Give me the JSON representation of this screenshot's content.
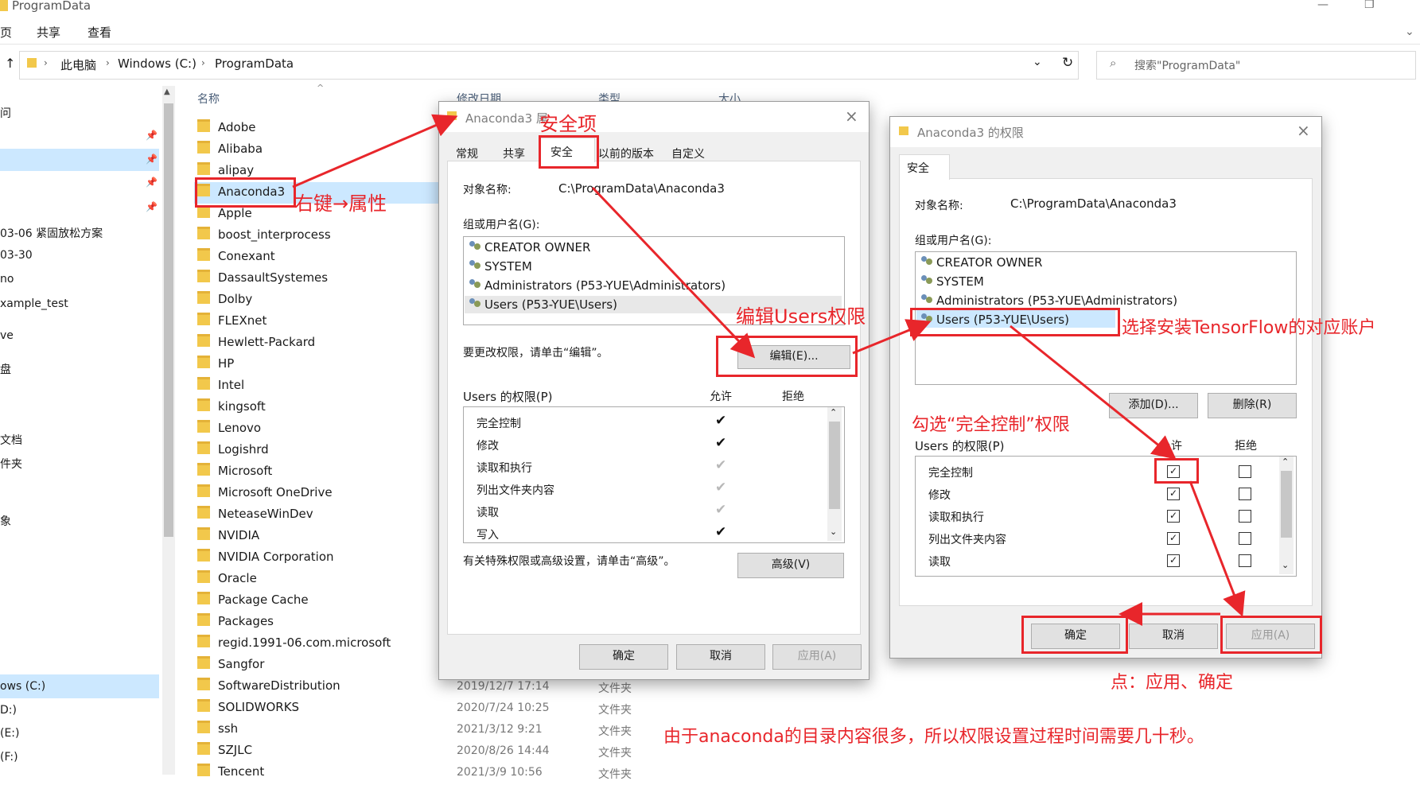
{
  "window": {
    "title": "ProgramData",
    "ribbon_tabs": [
      "页",
      "共享",
      "查看"
    ]
  },
  "address": {
    "crumbs": [
      "此电脑",
      "Windows (C:)",
      "ProgramData"
    ],
    "search_placeholder": "搜索\"ProgramData\""
  },
  "nav": {
    "items": [
      "问",
      "03-06 紧固放松方案",
      "03-30",
      "no",
      "xample_test",
      "ve",
      "盘",
      "文档",
      "件夹",
      "象",
      "ows (C:)",
      "D:)",
      "(E:)",
      "(F:)"
    ]
  },
  "columns": {
    "name": "名称",
    "modified": "修改日期",
    "type": "类型",
    "size": "大小"
  },
  "folders": [
    "Adobe",
    "Alibaba",
    "alipay",
    "Anaconda3",
    "Apple",
    "boost_interprocess",
    "Conexant",
    "DassaultSystemes",
    "Dolby",
    "FLEXnet",
    "Hewlett-Packard",
    "HP",
    "Intel",
    "kingsoft",
    "Lenovo",
    "Logishrd",
    "Microsoft",
    "Microsoft OneDrive",
    "NeteaseWinDev",
    "NVIDIA",
    "NVIDIA Corporation",
    "Oracle",
    "Package Cache",
    "Packages",
    "regid.1991-06.com.microsoft",
    "Sangfor",
    "SoftwareDistribution",
    "SOLIDWORKS",
    "ssh",
    "SZJLC",
    "Tencent"
  ],
  "visible_modified": [
    {
      "date": "2019/12/7 17:14",
      "type": "文件夹"
    },
    {
      "date": "2020/7/24 10:25",
      "type": "文件夹"
    },
    {
      "date": "2021/3/12 9:21",
      "type": "文件夹"
    },
    {
      "date": "2020/8/26 14:44",
      "type": "文件夹"
    },
    {
      "date": "2021/3/9 10:56",
      "type": "文件夹"
    }
  ],
  "properties": {
    "title": "Anaconda3 属",
    "tabs": [
      "常规",
      "共享",
      "安全",
      "以前的版本",
      "自定义"
    ],
    "object_label": "对象名称:",
    "object_value": "C:\\ProgramData\\Anaconda3",
    "group_label": "组或用户名(G):",
    "users": [
      "CREATOR OWNER",
      "SYSTEM",
      "Administrators (P53-YUE\\Administrators)",
      "Users (P53-YUE\\Users)"
    ],
    "change_hint": "要更改权限，请单击“编辑”。",
    "edit_button": "编辑(E)...",
    "perm_label": "Users 的权限(P)",
    "allow": "允许",
    "deny": "拒绝",
    "perms": [
      "完全控制",
      "修改",
      "读取和执行",
      "列出文件夹内容",
      "读取",
      "写入"
    ],
    "allow_states": [
      "check",
      "check",
      "grey",
      "grey",
      "grey",
      "check"
    ],
    "advanced_hint": "有关特殊权限或高级设置，请单击“高级”。",
    "advanced_button": "高级(V)",
    "ok": "确定",
    "cancel": "取消",
    "apply": "应用(A)"
  },
  "permissions": {
    "title": "Anaconda3 的权限",
    "tab": "安全",
    "object_label": "对象名称:",
    "object_value": "C:\\ProgramData\\Anaconda3",
    "group_label": "组或用户名(G):",
    "users": [
      "CREATOR OWNER",
      "SYSTEM",
      "Administrators (P53-YUE\\Administrators)",
      "Users (P53-YUE\\Users)"
    ],
    "add_button": "添加(D)...",
    "remove_button": "删除(R)",
    "perm_label": "Users 的权限(P)",
    "allow": "允许",
    "deny": "拒绝",
    "perms": [
      "完全控制",
      "修改",
      "读取和执行",
      "列出文件夹内容",
      "读取"
    ],
    "ok": "确定",
    "cancel": "取消",
    "apply": "应用(A)"
  },
  "annotations": {
    "a1": "右键→属性",
    "a2": "安全项",
    "a3": "编辑Users权限",
    "a4": "选择安装TensorFlow的对应账户",
    "a5": "勾选“完全控制”权限",
    "a6": "点：应用、确定",
    "a7": "由于anaconda的目录内容很多，所以权限设置过程时间需要几十秒。"
  },
  "colors": {
    "annotation": "#e8262b",
    "selection": "#cce8ff",
    "folder": "#f2c84b"
  }
}
